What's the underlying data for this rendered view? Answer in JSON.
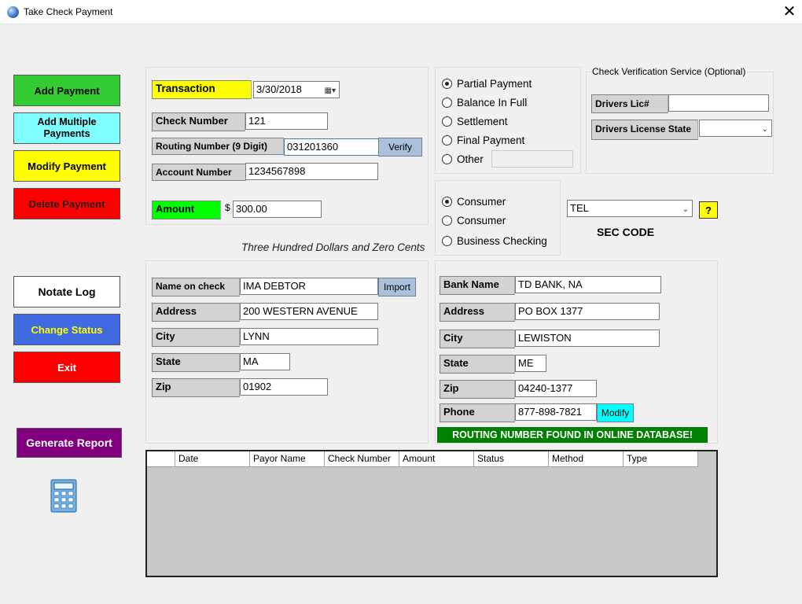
{
  "window": {
    "title": "Take Check Payment",
    "close": "✕"
  },
  "left_buttons": {
    "add_payment": "Add Payment",
    "add_multiple_payments": "Add Multiple Payments",
    "modify_payment": "Modify Payment",
    "delete_payment": "Delete Payment",
    "notate_log": "Notate Log",
    "change_status": "Change Status",
    "exit": "Exit",
    "generate_report": "Generate Report"
  },
  "transaction": {
    "transaction_label": "Transaction",
    "transaction_date": "3/30/2018",
    "check_number_label": "Check Number",
    "check_number": "121",
    "routing_label": "Routing Number (9 Digit)",
    "routing_number": "031201360",
    "verify_label": "Verify",
    "account_label": "Account Number",
    "account_number": "1234567898",
    "amount_label": "Amount",
    "currency_symbol": "$",
    "amount": "300.00",
    "amount_words": "Three Hundred  Dollars and Zero Cents"
  },
  "payment_type": {
    "options": [
      "Partial Payment",
      "Balance In Full",
      "Settlement",
      "Final Payment",
      "Other"
    ],
    "selected": "Partial Payment",
    "other_value": ""
  },
  "verification": {
    "legend": "Check Verification Service (Optional)",
    "drivers_lic_label": "Drivers Lic#",
    "drivers_lic_value": "",
    "drivers_state_label": "Drivers License State",
    "drivers_state_value": ""
  },
  "account_type": {
    "options": [
      "Consumer",
      "Consumer",
      "Business Checking"
    ],
    "selected_index": 0
  },
  "sec": {
    "value": "TEL",
    "label": "SEC CODE",
    "help": "?"
  },
  "payor": {
    "name_label": "Name on check",
    "name": "IMA DEBTOR",
    "import_label": "Import",
    "address_label": "Address",
    "address": "200 WESTERN AVENUE",
    "city_label": "City",
    "city": "LYNN",
    "state_label": "State",
    "state": "MA",
    "zip_label": "Zip",
    "zip": "01902"
  },
  "bank": {
    "name_label": "Bank Name",
    "name": "TD BANK, NA",
    "address_label": "Address",
    "address": "PO BOX 1377",
    "city_label": "City",
    "city": "LEWISTON",
    "state_label": "State",
    "state": "ME",
    "zip_label": "Zip",
    "zip": "04240-1377",
    "phone_label": "Phone",
    "phone": "877-898-7821",
    "modify_label": "Modify",
    "routing_status": "ROUTING NUMBER FOUND IN ONLINE DATABASE!"
  },
  "grid": {
    "columns": [
      "",
      "Date",
      "Payor Name",
      "Check Number",
      "Amount",
      "Status",
      "Method",
      "Type"
    ],
    "rows": []
  },
  "colors": {
    "add_payment": "#33cc33",
    "add_multiple": "#7fffff",
    "modify": "#ffff00",
    "delete": "#ff0000",
    "notate": "#ffffff",
    "change_status": "#4169e1",
    "exit": "#ff0000",
    "generate_report": "#800080",
    "amount_label": "#00ff00",
    "transaction_label": "#ffff00",
    "routing_banner": "#008000"
  },
  "icons": {
    "app": "globe-icon",
    "calculator": "calculator-icon",
    "calendar": "calendar-icon"
  }
}
